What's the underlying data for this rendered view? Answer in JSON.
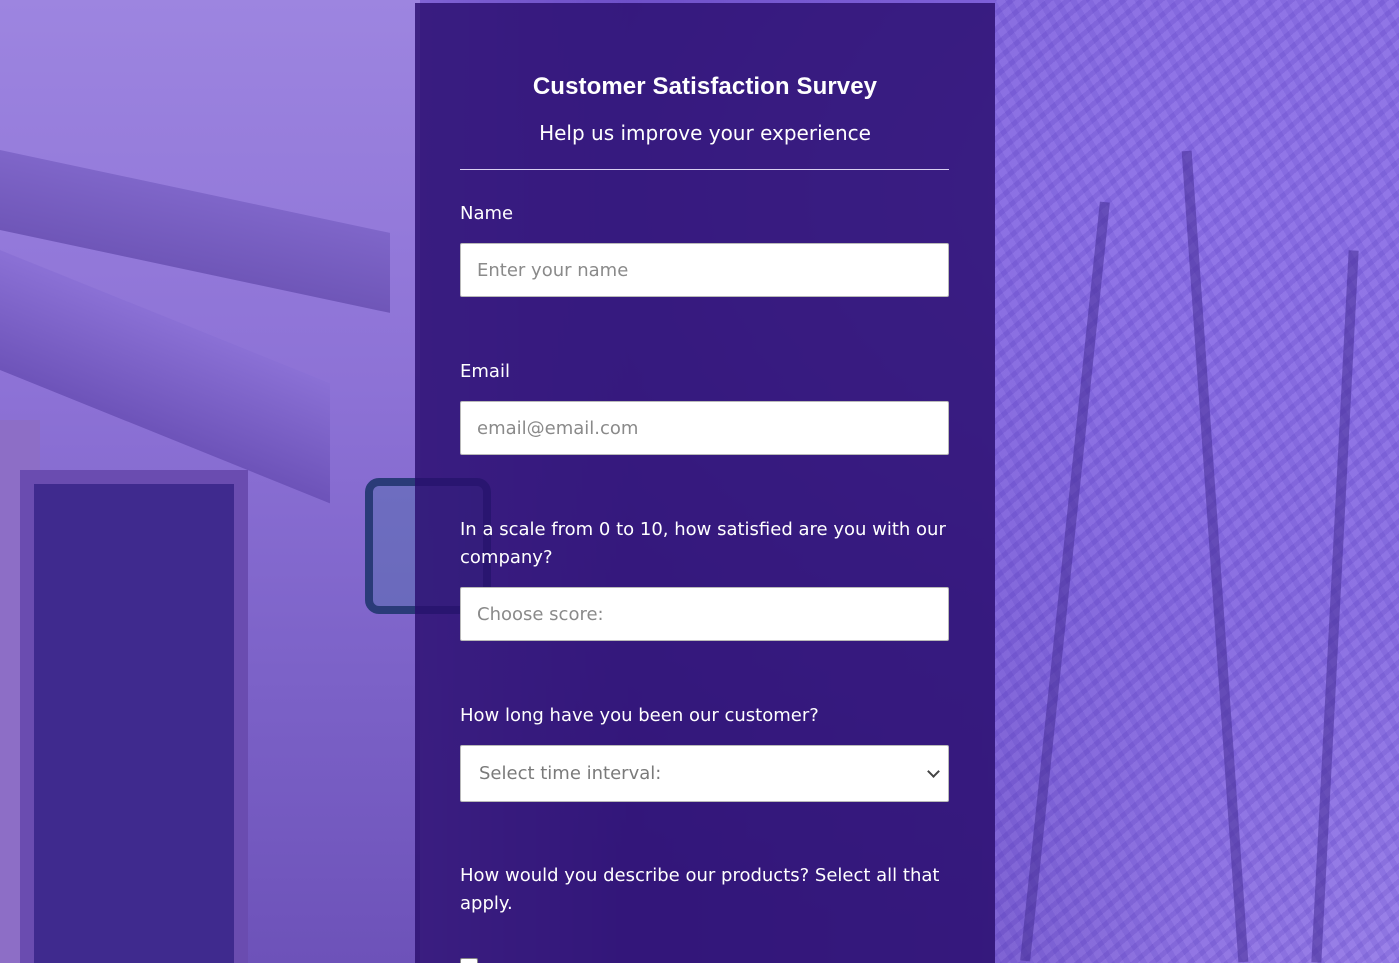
{
  "survey": {
    "title": "Customer Satisfaction Survey",
    "subtitle": "Help us improve your experience"
  },
  "fields": {
    "name": {
      "label": "Name",
      "placeholder": "Enter your name"
    },
    "email": {
      "label": "Email",
      "placeholder": "email@email.com"
    },
    "score": {
      "label": "In a scale from 0 to 10, how satisfied are you with our company?",
      "placeholder": "Choose score:"
    },
    "customer_duration": {
      "label": "How long have you been our customer?",
      "selected": "Select time interval:"
    },
    "products": {
      "label": "How would you describe our products? Select all that apply."
    }
  },
  "colors": {
    "panel": "#2a0e6e",
    "background_tint": "#8a6ad8",
    "text": "#ffffff"
  }
}
